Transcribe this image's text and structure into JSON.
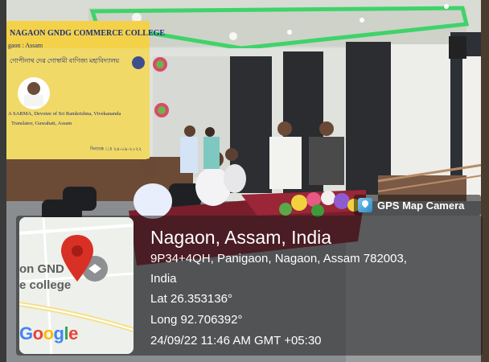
{
  "banner": {
    "line1": "NAGAON GNDG COMMERCE COLLEGE",
    "line2": "gaon : Assam",
    "line3": "গোপীনাথ দেৱ গোস্বামী বাণিজ্য মহাবিদ্যালয়",
    "line4": "A SARMA, Devotee of Sri Ramkrishna, Vivekananda",
    "line5": "Translator, Guwahati, Assam",
    "line6": "দিনাংক ঃ ২৪-০৯-২০২২"
  },
  "gps_badge": {
    "label": "GPS Map Camera"
  },
  "map": {
    "place_text_1": "on GND",
    "place_text_2": "e college",
    "google_letters": [
      "G",
      "o",
      "o",
      "g",
      "l",
      "e"
    ]
  },
  "location": {
    "title": "Nagaon, Assam, India",
    "address_line1": "9P34+4QH, Panigaon, Nagaon, Assam 782003,",
    "address_line2": "India",
    "lat": "Lat 26.353136°",
    "long": "Long 92.706392°",
    "timestamp": "24/09/22 11:46 AM GMT +05:30"
  },
  "colors": {
    "map_pin": "#d93025",
    "overlay": "#191919",
    "banner_bg": "#f4e06a",
    "table_cloth": "#7a1e2c"
  }
}
